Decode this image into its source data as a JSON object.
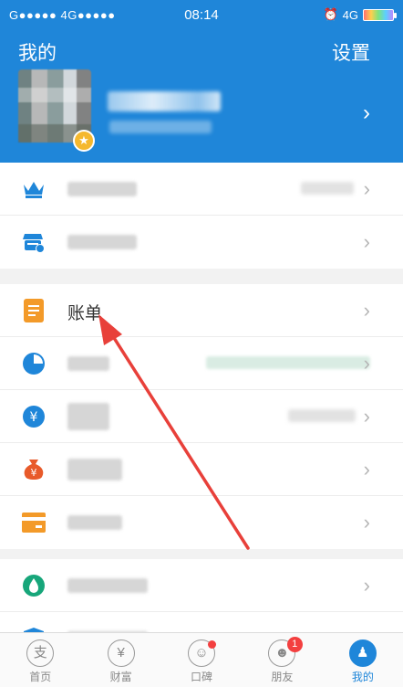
{
  "status": {
    "carrier": "G●●●●● 4G●●●●●",
    "time": "08:14",
    "network": "4G"
  },
  "header": {
    "title": "我的",
    "settings": "设置"
  },
  "menu": {
    "bill_label": "账单"
  },
  "tabs": [
    {
      "label": "首页",
      "glyph": "支"
    },
    {
      "label": "财富",
      "glyph": "¥"
    },
    {
      "label": "口碑",
      "glyph": "☺"
    },
    {
      "label": "朋友",
      "glyph": "☻",
      "badge": "1"
    },
    {
      "label": "我的",
      "glyph": "♟"
    }
  ],
  "colors": {
    "brand": "#1f86d9",
    "bill": "#f39a29",
    "annotation": "#e8403a"
  }
}
